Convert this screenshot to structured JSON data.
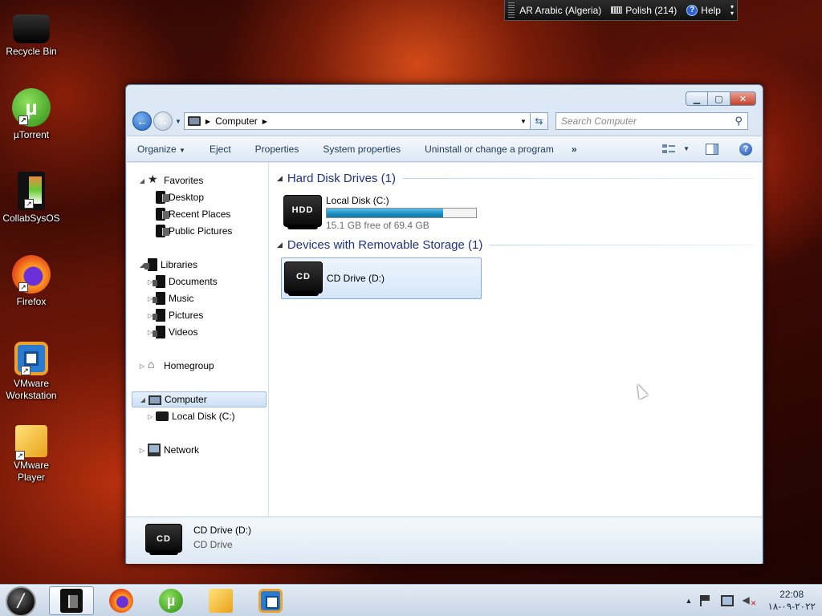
{
  "desktop": {
    "icons": [
      {
        "label": "Recycle Bin",
        "icon": "recycle-bin-icon"
      },
      {
        "label": "µTorrent",
        "icon": "utorrent-icon"
      },
      {
        "label": "CollabSysOS",
        "icon": "collabsysos-icon"
      },
      {
        "label": "Firefox",
        "icon": "firefox-icon"
      },
      {
        "label": "VMware Workstation",
        "icon": "vmware-workstation-icon"
      },
      {
        "label": "VMware Player",
        "icon": "vmware-player-icon"
      }
    ]
  },
  "language_bar": {
    "language": "AR Arabic (Algeria)",
    "keyboard": "Polish (214)",
    "help": "Help"
  },
  "window": {
    "address": {
      "location": "Computer"
    },
    "search": {
      "placeholder": "Search Computer"
    },
    "toolbar": {
      "organize": "Organize",
      "eject": "Eject",
      "properties": "Properties",
      "system_properties": "System properties",
      "uninstall": "Uninstall or change a program",
      "more": "»"
    },
    "nav_pane": {
      "favorites": "Favorites",
      "desktop": "Desktop",
      "recent_places": "Recent Places",
      "public_pictures": "Public Pictures",
      "libraries": "Libraries",
      "documents": "Documents",
      "music": "Music",
      "pictures": "Pictures",
      "videos": "Videos",
      "homegroup": "Homegroup",
      "computer": "Computer",
      "local_disk": "Local Disk (C:)",
      "network": "Network"
    },
    "groups": {
      "hard_disk": {
        "title": "Hard Disk Drives (1)",
        "drive_name": "Local Disk (C:)",
        "drive_icon_label": "HDD",
        "free_text": "15.1 GB free of 69.4 GB",
        "used_fraction": 0.78
      },
      "removable": {
        "title": "Devices with Removable Storage (1)",
        "drive_name": "CD Drive (D:)",
        "drive_icon_label": "CD"
      }
    },
    "details": {
      "name": "CD Drive (D:)",
      "type": "CD Drive",
      "icon_label": "CD"
    }
  },
  "taskbar": {
    "clock": {
      "time": "22:08",
      "date": "٢٠٢٢-٠٩-١٨"
    }
  },
  "colors": {
    "capacity_bar": "#1c8fc4",
    "group_heading": "#1e3287",
    "selection": "#cde0f5"
  }
}
